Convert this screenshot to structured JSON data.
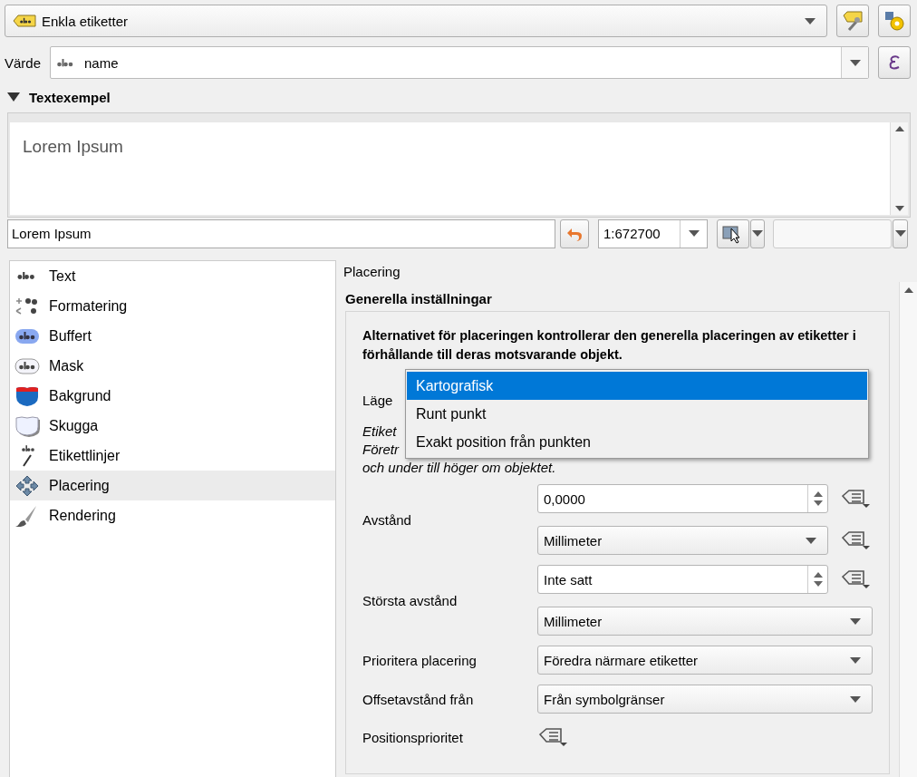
{
  "renderer": {
    "label": "Enkla etiketter"
  },
  "value": {
    "label": "Värde",
    "field": "name"
  },
  "preview": {
    "title": "Textexempel",
    "expanded": true,
    "sample": "Lorem Ipsum",
    "input": "Lorem Ipsum",
    "scale": "1:672700"
  },
  "sections": [
    {
      "label": "Text",
      "kind": "text",
      "selected": false
    },
    {
      "label": "Formatering",
      "kind": "formatting",
      "selected": false
    },
    {
      "label": "Buffert",
      "kind": "buffer",
      "selected": false
    },
    {
      "label": "Mask",
      "kind": "mask",
      "selected": false
    },
    {
      "label": "Bakgrund",
      "kind": "background",
      "selected": false
    },
    {
      "label": "Skugga",
      "kind": "shadow",
      "selected": false
    },
    {
      "label": "Etikettlinjer",
      "kind": "callouts",
      "selected": false
    },
    {
      "label": "Placering",
      "kind": "placement",
      "selected": true
    },
    {
      "label": "Rendering",
      "kind": "rendering",
      "selected": false
    }
  ],
  "panel": {
    "title": "Placering",
    "group": "Generella inställningar",
    "description": "Alternativet för placeringen kontrollerar den generella placeringen av etiketter i förhållande till deras motsvarande objekt.",
    "mode_label": "Läge",
    "mode_options": [
      {
        "label": "Kartografisk",
        "selected": true
      },
      {
        "label": "Runt punkt",
        "selected": false
      },
      {
        "label": "Exakt position från punkten",
        "selected": false
      }
    ],
    "hint_lines": [
      "Etiket",
      "Företr",
      "och under till höger om objektet."
    ],
    "fields": [
      {
        "label": "Avstånd",
        "controls": [
          {
            "kind": "spin",
            "value": "0,0000",
            "data_defined": true
          },
          {
            "kind": "combo",
            "value": "Millimeter",
            "data_defined": true
          }
        ]
      },
      {
        "label": "Största avstånd",
        "controls": [
          {
            "kind": "spin",
            "value": "Inte satt",
            "data_defined": true
          },
          {
            "kind": "combo",
            "value": "Millimeter",
            "data_defined": false
          }
        ]
      },
      {
        "label": "Prioritera placering",
        "controls": [
          {
            "kind": "combo",
            "value": "Föredra närmare etiketter",
            "data_defined": false
          }
        ]
      },
      {
        "label": "Offsetavstånd från",
        "controls": [
          {
            "kind": "combo",
            "value": "Från symbolgränser",
            "data_defined": false
          }
        ]
      },
      {
        "label": "Positionsprioritet",
        "controls": [
          {
            "kind": "button",
            "data_defined": true
          }
        ]
      }
    ]
  }
}
